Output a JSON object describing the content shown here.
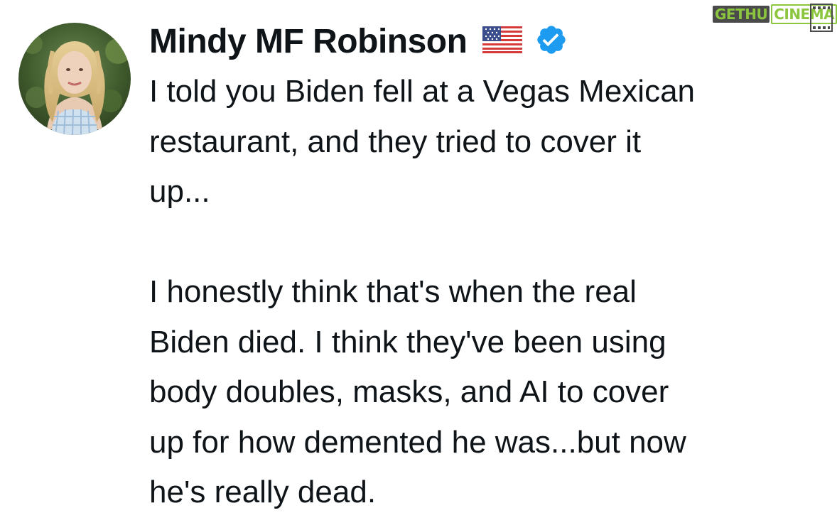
{
  "post": {
    "author": {
      "display_name": "Mindy MF Robinson",
      "flag_emoji": "🇺🇸",
      "verified": true,
      "verified_badge_color": "#1d9bf0",
      "avatar_icon": "profile-photo"
    },
    "text_paragraphs": [
      [
        "I told you Biden fell at a Vegas Mexican",
        "restaurant, and they tried to cover it",
        "up..."
      ],
      [
        "I honestly think that's when the real",
        "Biden died. I think they've been using",
        "body doubles, masks, and AI to cover",
        "up for how demented he was...but now",
        "he's really dead."
      ]
    ]
  },
  "watermark": {
    "part1": "GETHU",
    "part2": "CINEMA",
    "accent_color": "#8cc63f"
  }
}
